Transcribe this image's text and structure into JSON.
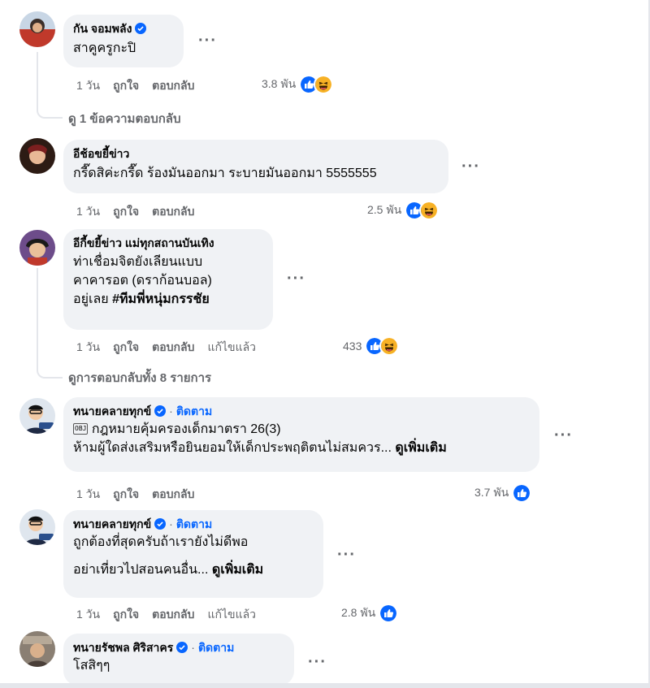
{
  "actions": {
    "like": "ถูกใจ",
    "reply": "ตอบกลับ",
    "edited": "แก้ไขแล้ว",
    "follow": "ติดตาม",
    "see_more": "ดูเพิ่มเติม"
  },
  "comments": [
    {
      "author": "กัน จอมพลัง",
      "text": "สาคูครูกะปิ",
      "time": "1 วัน",
      "reactions": "3.8 พัน"
    },
    {
      "author": "อีช้อขยี้ข่าว",
      "text": "กรี๊ดสิค่ะกรี๊ด ร้องมันออกมา ระบายมันออกมา 5555555",
      "time": "1 วัน",
      "reactions": "2.5 พัน"
    },
    {
      "author": "อีกี้ขยี้ข่าว แม่ทุกสถานบันเทิง",
      "lines": [
        "ท่าเชื่อมจิตยังเลียนแบบ",
        "คาคารอต (ดราก้อนบอล)",
        "อยู่เลย "
      ],
      "hashtag": "#ทีมพี่หนุ่มกรรชัย",
      "time": "1 วัน",
      "reactions": "433"
    },
    {
      "author": "ทนายคลายทุกข์",
      "obj_label": "OBJ",
      "line1": "กฎหมายคุ้มครองเด็กมาตรา 26(3)",
      "line2": "ห้ามผู้ใดส่งเสริมหรือยินยอมให้เด็กประพฤติตนไม่สมควร... ",
      "time": "1 วัน",
      "reactions": "3.7 พัน"
    },
    {
      "author": "ทนายคลายทุกข์",
      "line1": "ถูกต้องที่สุดครับถ้าเรายังไม่ดีพอ",
      "line2": "อย่าเที่ยวไปสอนคนอื่น... ",
      "time": "1 วัน",
      "reactions": "2.8 พัน"
    },
    {
      "author": "ทนายรัชพล ศิริสาคร",
      "text": "โสสิๆๆ"
    }
  ],
  "view_replies": [
    "ดู 1 ข้อความตอบกลับ",
    "ดูการตอบกลับทั้ง 8 รายการ"
  ],
  "colors": {
    "like": "#0866ff",
    "haha": "#f7b125",
    "link": "#0866ff",
    "bubble": "#f0f2f5",
    "muted": "#65676b"
  },
  "icons": {
    "verified": "verified-badge-icon",
    "like": "like-reaction-icon",
    "haha": "haha-reaction-icon",
    "more": "more-options-icon"
  }
}
